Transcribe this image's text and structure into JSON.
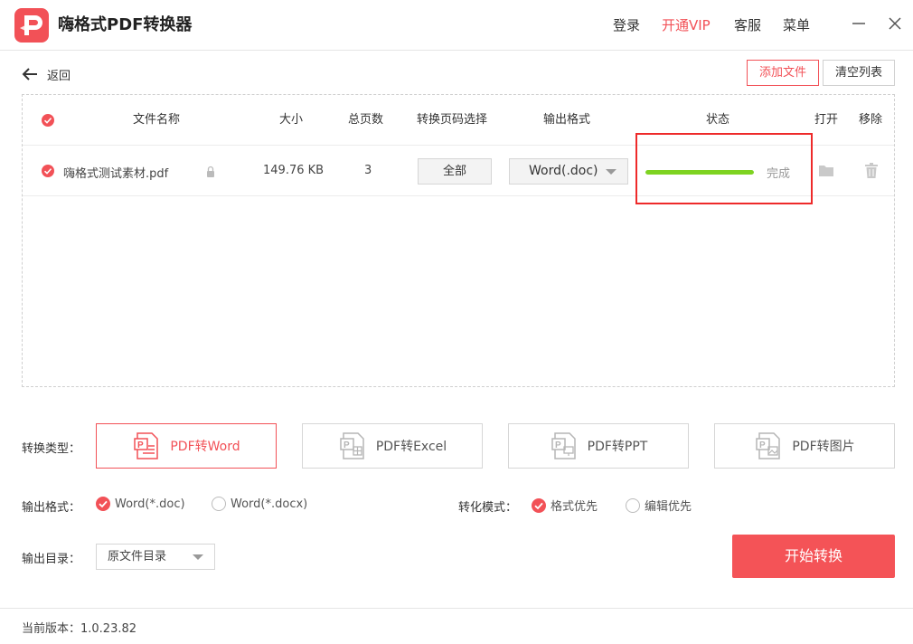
{
  "app": {
    "title": "嗨格式PDF转换器",
    "accent_color": "#f25157"
  },
  "header": {
    "nav": {
      "login": "登录",
      "vip": "开通VIP",
      "service": "客服",
      "menu": "菜单"
    },
    "window_controls": [
      "minimize-icon",
      "close-icon"
    ]
  },
  "toolbar": {
    "back_label": "返回",
    "add_file_label": "添加文件",
    "clear_list_label": "清空列表"
  },
  "table": {
    "columns": {
      "name": "文件名称",
      "size": "大小",
      "pages": "总页数",
      "page_range": "转换页码选择",
      "format": "输出格式",
      "status": "状态",
      "open": "打开",
      "remove": "移除"
    },
    "rows": [
      {
        "checked": true,
        "name": "嗨格式测试素材.pdf",
        "size": "149.76 KB",
        "pages": "3",
        "page_range": "全部",
        "format": "Word(.doc)",
        "progress": 1.0,
        "status": "完成",
        "progress_color": "#7ed321"
      }
    ]
  },
  "convert": {
    "type_label": "转换类型：",
    "types": [
      {
        "label": "PDF转Word",
        "active": true
      },
      {
        "label": "PDF转Excel",
        "active": false
      },
      {
        "label": "PDF转PPT",
        "active": false
      },
      {
        "label": "PDF转图片",
        "active": false
      }
    ],
    "output_format_label": "输出格式：",
    "output_formats": [
      {
        "label": "Word(*.doc)",
        "selected": true
      },
      {
        "label": "Word(*.docx)",
        "selected": false
      }
    ],
    "mode_label": "转化模式：",
    "modes": [
      {
        "label": "格式优先",
        "selected": true
      },
      {
        "label": "编辑优先",
        "selected": false
      }
    ],
    "output_dir_label": "输出目录：",
    "output_dir_value": "原文件目录",
    "start_label": "开始转换"
  },
  "footer": {
    "version": "当前版本：1.0.23.82"
  }
}
